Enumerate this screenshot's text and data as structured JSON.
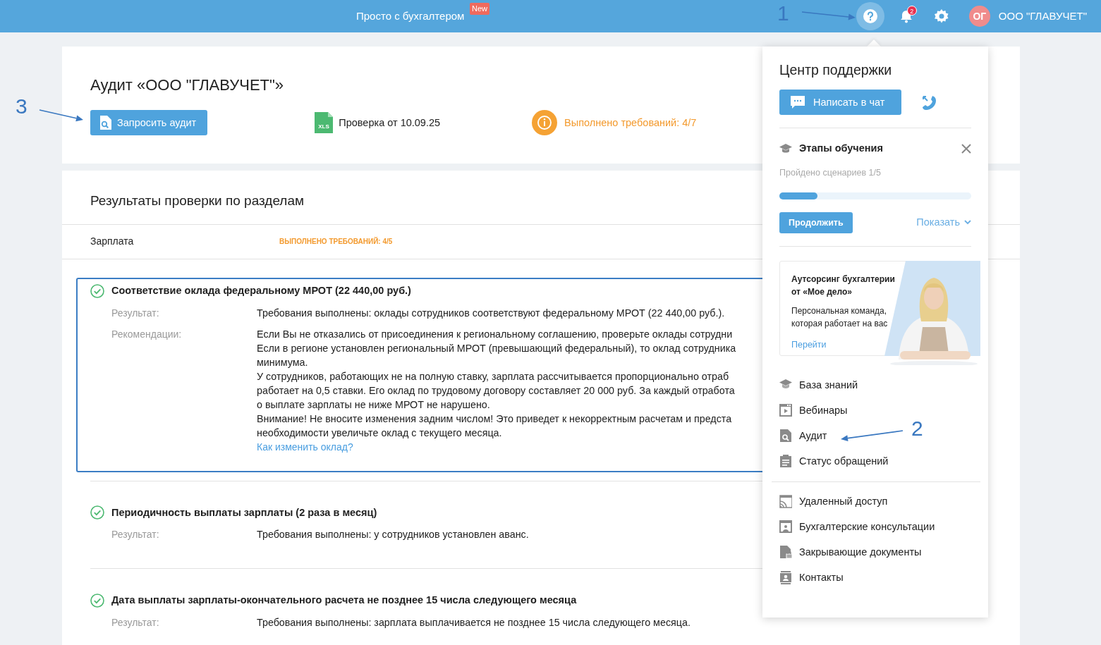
{
  "header": {
    "title": "Просто с бухгалтером",
    "badge": "New",
    "notifications": "2",
    "avatar": "ОГ",
    "company": "ООО \"ГЛАВУЧЕТ\""
  },
  "audit": {
    "title": "Аудит «ООО \"ГЛАВУЧЕТ\"»",
    "request_button": "Запросить аудит",
    "file_type": "XLS",
    "file": "Проверка от 10.09.25",
    "status": "Выполнено требований: 4/7"
  },
  "results": {
    "title": "Результаты проверки по разделам",
    "section": {
      "name": "Зарплата",
      "status": "ВЫПОЛНЕНО ТРЕБОВАНИЙ: 4/5"
    },
    "items": [
      {
        "title": "Соответствие оклада федеральному МРОТ (22 440,00 руб.)",
        "selected": true,
        "rows": [
          {
            "label": "Результат:",
            "lines": [
              "Требования выполнены: оклады сотрудников соответствуют федеральному МРОТ (22 440,00 руб.)."
            ]
          },
          {
            "label": "Рекомендации:",
            "lines": [
              "Если Вы не отказались от присоединения к региональному соглашению, проверьте оклады сотрудни",
              "Если в регионе установлен региональный МРОТ (превышающий федеральный), то оклад сотрудника",
              "минимума.",
              "У сотрудников, работающих не на полную ставку, зарплата рассчитывается пропорционально отраб",
              "работает на 0,5 ставки. Его оклад по трудовому договору составляет 20 000 руб. За каждый отработа",
              "о выплате зарплаты не ниже МРОТ не нарушено.",
              "Внимание! Не вносите изменения задним числом! Это приведет к некорректным расчетам и предста",
              "необходимости увеличьте оклад с текущего месяца."
            ],
            "link": "Как изменить оклад?"
          }
        ]
      },
      {
        "title": "Периодичность выплаты зарплаты (2 раза в месяц)",
        "selected": false,
        "rows": [
          {
            "label": "Результат:",
            "lines": [
              "Требования выполнены: у сотрудников установлен аванс."
            ]
          }
        ]
      },
      {
        "title": "Дата выплаты зарплаты-окончательного расчета не позднее 15 числа следующего месяца",
        "selected": false,
        "rows": [
          {
            "label": "Результат:",
            "lines": [
              "Требования выполнены: зарплата выплачивается не позднее 15 числа следующего месяца."
            ]
          }
        ]
      }
    ]
  },
  "support": {
    "title": "Центр поддержки",
    "chat_button": "Написать в чат",
    "learning": {
      "title": "Этапы обучения",
      "progress_text": "Пройдено сценариев 1/5",
      "level": 0.2,
      "continue_button": "Продолжить",
      "show_link": "Показать"
    },
    "promo": {
      "title": "Аутсорсинг бухгалтерии от «Мое дело»",
      "text": "Персональная команда, которая работает на вас",
      "link": "Перейти"
    },
    "menu_groups": [
      [
        {
          "label": "База знаний",
          "kind": "cap"
        },
        {
          "label": "Вебинары",
          "kind": "video"
        },
        {
          "label": "Аудит",
          "kind": "audit"
        },
        {
          "label": "Статус обращений",
          "kind": "clipboard"
        }
      ],
      [
        {
          "label": "Удаленный доступ",
          "kind": "remote"
        },
        {
          "label": "Бухгалтерские консультации",
          "kind": "consult"
        },
        {
          "label": "Закрывающие документы",
          "kind": "lockdoc"
        },
        {
          "label": "Контакты",
          "kind": "contacts"
        }
      ]
    ]
  },
  "annotations": [
    "1",
    "2",
    "3"
  ]
}
